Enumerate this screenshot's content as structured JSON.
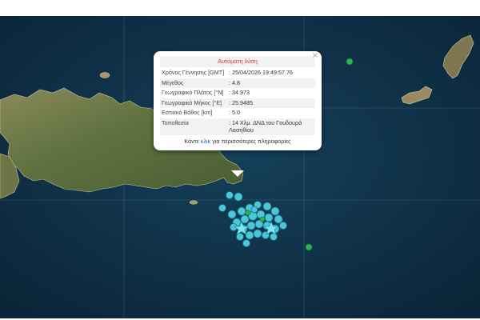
{
  "popup": {
    "title": "Αυτόματη λύση",
    "close_glyph": "×",
    "rows": [
      {
        "label": "Χρόνος Γέννησης [GMT]",
        "value": ": 25/04/2026 19:49:57.76"
      },
      {
        "label": "Μέγεθος",
        "value": ": 4.8"
      },
      {
        "label": "Γεωγραφικό Πλάτος [°N]",
        "value": ": 34.973"
      },
      {
        "label": "Γεωγραφικό Μήκος [°E]",
        "value": ": 25.9485"
      },
      {
        "label": "Εστιακό Βάθος [km]",
        "value": ": 5.0"
      },
      {
        "label": "Τοποθεσία",
        "value": ": 14 Χλμ. ΔΝΔ του Γουδουρά Λασηθίου"
      }
    ],
    "more_prefix": "Κάντε ",
    "more_link": "κλικ",
    "more_suffix": " για περισσότερες πληροφορίες"
  },
  "colors": {
    "sea": "#0f2f45",
    "land": "#5b6e3e",
    "land_dry": "#9a8a62",
    "event_marker": "#4fd0e0",
    "event_marker_stroke": "#1c6f8a",
    "old_event": "#2fb352",
    "star_marker": "#7fe6f0",
    "alert_title": "#e03030"
  },
  "markers": {
    "icons": [
      "event-circle-icon",
      "star-icon",
      "green-dot-icon"
    ]
  }
}
